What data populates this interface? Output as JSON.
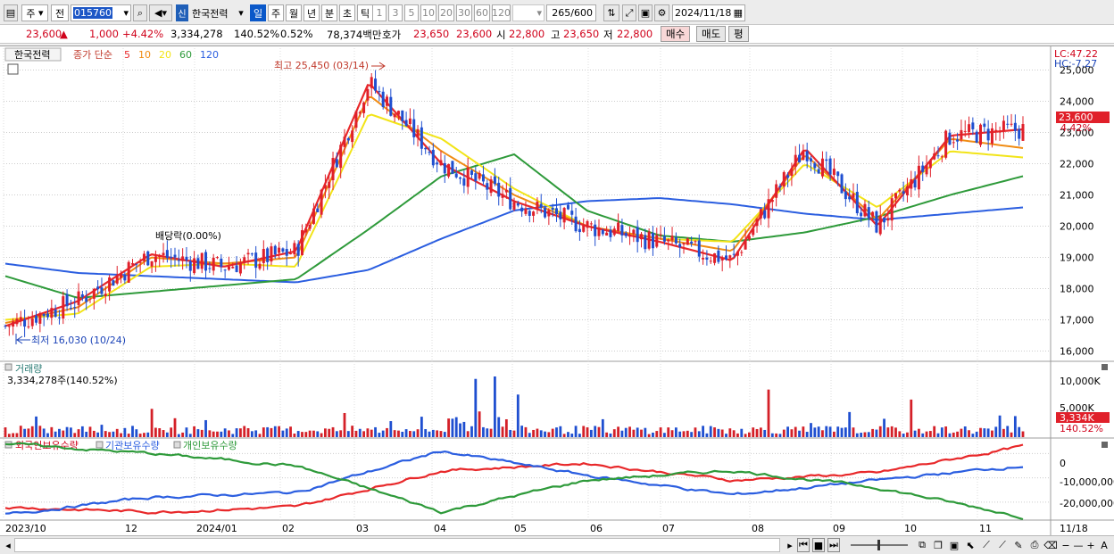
{
  "toolbar": {
    "type_label": "주",
    "type_arrow": "▾",
    "prev_label": "전",
    "code_value": "015760",
    "new_badge": "신",
    "stock_name": "한국전력",
    "periods": [
      "일",
      "주",
      "월",
      "년",
      "분",
      "초",
      "틱"
    ],
    "active_period": "일",
    "intervals": [
      "1",
      "3",
      "5",
      "10",
      "20",
      "30",
      "60",
      "120"
    ],
    "count_value": "265",
    "count_total": "/600",
    "date_value": "2024/11/18"
  },
  "quote": {
    "price": "23,600",
    "change_arrow": "▲",
    "change": "1,000",
    "change_pct": "+4.42%",
    "volume": "3,334,278",
    "vol_ratio": "140.52%",
    "turnover": "0.52%",
    "amount": "78,374백만",
    "bid_label": "호가",
    "ask_price": "23,650",
    "bid_price": "23,600",
    "open_label": "시",
    "open": "22,800",
    "high_label": "고",
    "high": "23,650",
    "low_label": "저",
    "low": "22,800",
    "buy_label": "매수",
    "sell_label": "매도",
    "avg_label": "평"
  },
  "price_panel": {
    "name": "한국전력",
    "ma_label": "종가 단순",
    "ma_periods": [
      "5",
      "10",
      "20",
      "60",
      "120"
    ],
    "ma_colors": [
      "#e8282a",
      "#f08c14",
      "#f2e418",
      "#2e9a3a",
      "#2b5ee0"
    ],
    "lc": "LC:47.22",
    "hc": "HC:-7.27",
    "high_annot": "최고 25,450 (03/14)",
    "low_annot": "최저 16,030 (10/24)",
    "div_annot": "배당락(0.00%)",
    "price_tag": "23,600",
    "pct_tag": "4.42%",
    "y_ticks": [
      "25,000",
      "24,000",
      "23,000",
      "22,000",
      "21,000",
      "20,000",
      "19,000",
      "18,000",
      "17,000",
      "16,000"
    ]
  },
  "volume_panel": {
    "title": "거래량",
    "value_line": "3,334,278주(140.52%)",
    "tag": "3,334K",
    "pct_tag": "140.52%",
    "y_ticks": [
      "10,000K",
      "5,000K"
    ]
  },
  "holding_panel": {
    "titles": [
      "외국인보유수량",
      "기관보유수량",
      "개인보유수량"
    ],
    "colors": [
      "#e8282a",
      "#2b5ee0",
      "#2e9a3a"
    ],
    "y_ticks": [
      "0",
      "-10,000,000",
      "-20,000,000"
    ]
  },
  "x_ticks": [
    "2023/10",
    "12",
    "2024/01",
    "02",
    "03",
    "04",
    "05",
    "06",
    "07",
    "08",
    "09",
    "10",
    "11",
    "11/18"
  ],
  "chart_data": [
    {
      "type": "line",
      "title": "한국전력",
      "x": [
        "2023/10",
        "2023/11",
        "2023/12",
        "2024/01",
        "2024/02",
        "2024/03",
        "2024/04",
        "2024/05",
        "2024/06",
        "2024/07",
        "2024/08",
        "2024/09",
        "2024/10",
        "2024/11",
        "2024/11/18"
      ],
      "series": [
        {
          "name": "종가 단순 5",
          "values": [
            16800,
            17600,
            19100,
            18700,
            19200,
            24600,
            22000,
            20800,
            20000,
            19500,
            18900,
            22500,
            20000,
            22900,
            23100
          ]
        },
        {
          "name": "10",
          "values": [
            16900,
            17400,
            19000,
            18800,
            19000,
            24200,
            22400,
            21000,
            20000,
            19600,
            19200,
            22300,
            20200,
            22800,
            22500
          ]
        },
        {
          "name": "20",
          "values": [
            17000,
            17200,
            18700,
            18800,
            18700,
            23600,
            22800,
            21200,
            20000,
            19600,
            19500,
            22000,
            20600,
            22400,
            22200
          ]
        },
        {
          "name": "60",
          "values": [
            18400,
            17700,
            17900,
            18100,
            18300,
            19900,
            21600,
            22300,
            20500,
            19700,
            19500,
            19800,
            20300,
            21000,
            21600
          ]
        },
        {
          "name": "120",
          "values": [
            18800,
            18500,
            18400,
            18300,
            18200,
            18600,
            19600,
            20500,
            20800,
            20900,
            20700,
            20400,
            20200,
            20400,
            20600
          ]
        }
      ],
      "ylim": [
        15700,
        25700
      ]
    },
    {
      "type": "line",
      "title": "외국인보유수량 / 기관보유수량 / 개인보유수량",
      "x": [
        "2023/10",
        "2023/12",
        "2024/02",
        "2024/03",
        "2024/05",
        "2024/07",
        "2024/09",
        "2024/11/18"
      ],
      "series": [
        {
          "name": "외국인보유수량",
          "values": [
            -22000000,
            -24000000,
            -22000000,
            -7000000,
            -4000000,
            -11000000,
            -8000000,
            3000000
          ]
        },
        {
          "name": "기관보유수량",
          "values": [
            -25000000,
            -18000000,
            -16000000,
            1000000,
            -9000000,
            -17000000,
            -11000000,
            -5000000
          ]
        },
        {
          "name": "개인보유수량",
          "values": [
            4000000,
            0,
            -5000000,
            -24000000,
            -11000000,
            -7000000,
            -14000000,
            -26000000
          ]
        }
      ],
      "ylim": [
        -27000000,
        6000000
      ]
    }
  ]
}
